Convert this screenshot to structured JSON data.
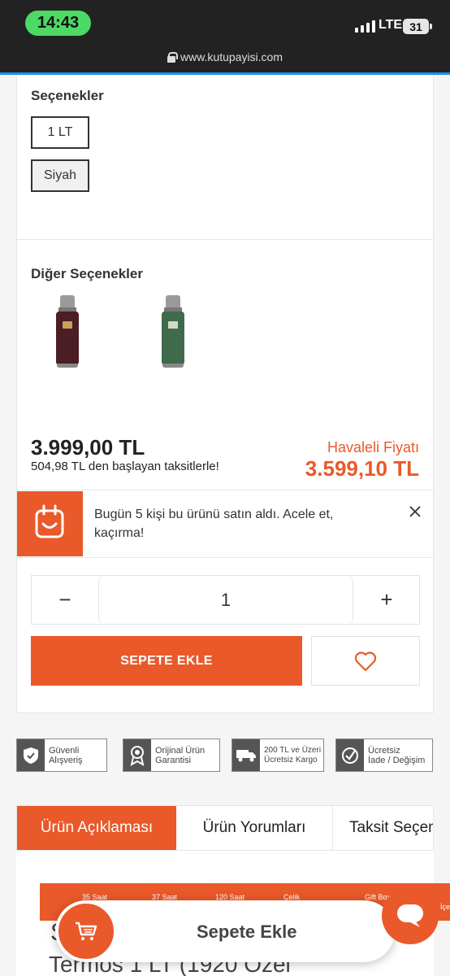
{
  "status_bar": {
    "time": "14:43",
    "network": "LTE",
    "battery": "31",
    "url": "www.kutupayisi.com"
  },
  "options": {
    "title": "Seçenekler",
    "sizes": [
      "1 LT"
    ],
    "colors": [
      "Siyah"
    ]
  },
  "other_options": {
    "title": "Diğer Seçenekler",
    "variants": [
      "bordo-thermos-icon",
      "green-thermos-icon"
    ]
  },
  "pricing": {
    "price": "3.999,00 TL",
    "installment": "504,98 TL den başlayan taksitlerle!",
    "transfer_label": "Havaleli Fiyatı",
    "transfer_price": "3.599,10 TL"
  },
  "notification": {
    "text": "Bugün 5  kişi bu ürünü satın aldı. Acele et, kaçırma!"
  },
  "quantity": {
    "minus": "−",
    "value": "1",
    "plus": "+"
  },
  "actions": {
    "add_to_cart": "SEPETE EKLE"
  },
  "badges": [
    {
      "line1": "Güvenli",
      "line2": "Alışveriş"
    },
    {
      "line1": "Orijinal Ürün",
      "line2": "Garantisi"
    },
    {
      "line1": "200 TL ve Üzeri",
      "line2": "Ücretsiz Kargo"
    },
    {
      "line1": "Ücretsiz",
      "line2": "İade / Değişim"
    }
  ],
  "tabs": [
    "Ürün Açıklaması",
    "Ürün Yorumları",
    "Taksit Seçenekleri"
  ],
  "banner": {
    "items": [
      "35 Saat",
      "37 Saat",
      "120 Saat",
      "Çelik",
      "Gift Box",
      "İçe"
    ]
  },
  "background_text": {
    "letter": "S",
    "title": "Termos 1 LT (1920 Özel"
  },
  "sticky": {
    "label": "Sepete Ekle"
  },
  "colors": {
    "accent": "#e9592a",
    "dark": "#222222",
    "status_green": "#4cd964"
  }
}
